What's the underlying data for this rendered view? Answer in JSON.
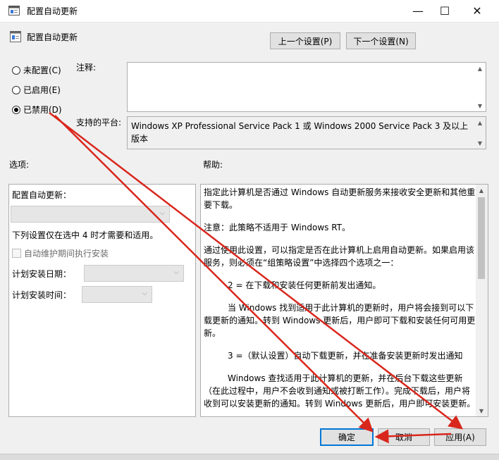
{
  "window": {
    "title": "配置自动更新",
    "minimize": "—",
    "maximize": "☐",
    "close": "✕"
  },
  "header": {
    "policy_name": "配置自动更新",
    "prev_button": "上一个设置(P)",
    "next_button": "下一个设置(N)"
  },
  "state": {
    "options": [
      {
        "label": "未配置(C)",
        "selected": false
      },
      {
        "label": "已启用(E)",
        "selected": false
      },
      {
        "label": "已禁用(D)",
        "selected": true
      }
    ]
  },
  "comment": {
    "label": "注释:",
    "value": ""
  },
  "platform": {
    "label": "支持的平台:",
    "value": "Windows XP Professional Service Pack 1 或 Windows 2000 Service Pack 3 及以上版本"
  },
  "options_section": {
    "title": "选项:",
    "configure_label": "配置自动更新：",
    "configure_value": "",
    "note": "下列设置仅在选中 4 时才需要和适用。",
    "maintenance_checkbox": "自动维护期间执行安装",
    "install_day_label": "计划安装日期：",
    "install_time_label": "计划安装时间："
  },
  "help_section": {
    "title": "帮助:",
    "paragraphs": [
      "指定此计算机是否通过 Windows 自动更新服务来接收安全更新和其他重要下载。",
      "注意：此策略不适用于 Windows RT。",
      "通过使用此设置，可以指定是否在此计算机上启用自动更新。如果启用该服务，则必须在“组策略设置”中选择四个选项之一：",
      "2 = 在下载和安装任何更新前发出通知。",
      "当 Windows 找到适用于此计算机的更新时，用户将会接到可以下载更新的通知。转到 Windows 更新后，用户即可下载和安装任何可用更新。",
      "3 =（默认设置）自动下载更新，并在准备安装更新时发出通知",
      "Windows 查找适用于此计算机的更新，并在后台下载这些更新（在此过程中，用户不会收到通知或被打断工作）。完成下载后，用户将收到可以安装更新的通知。转到 Windows 更新后，用户即可安装更新。"
    ]
  },
  "footer": {
    "ok": "确定",
    "cancel": "取消",
    "apply": "应用(A)"
  },
  "colors": {
    "annotation_arrow": "#d9261c",
    "default_button_border": "#0078d7"
  }
}
